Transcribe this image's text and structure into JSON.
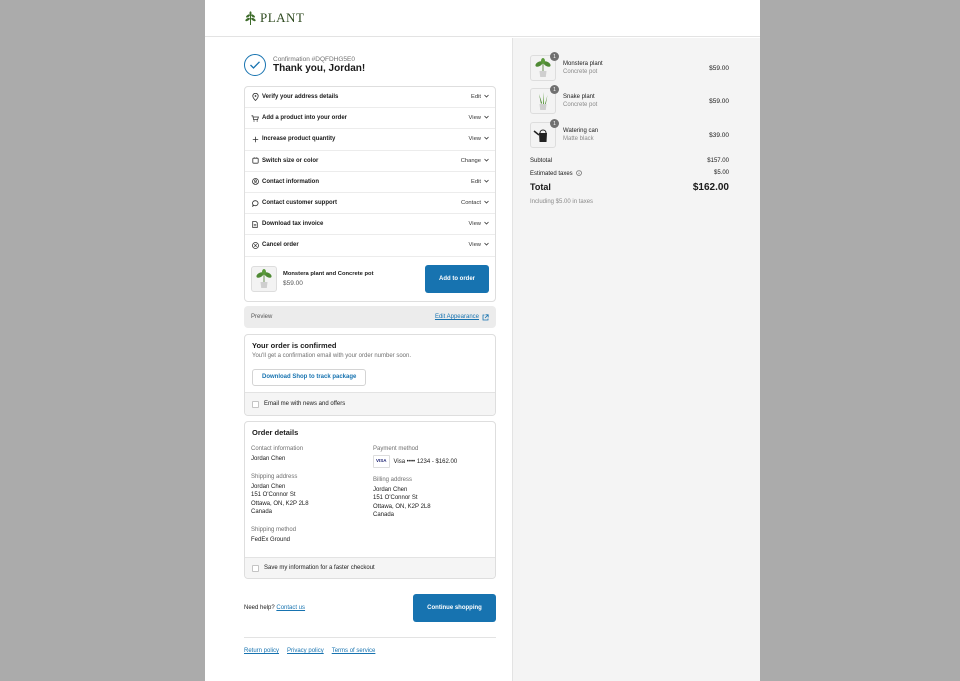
{
  "brand": {
    "name": "PLANT"
  },
  "confirmation": {
    "number": "Confirmation #DQFDHG5E0",
    "title": "Thank you, Jordan!"
  },
  "actions": [
    {
      "label": "Verify your address details",
      "action": "Edit",
      "icon": "location-pin-icon"
    },
    {
      "label": "Add a product into your order",
      "action": "View",
      "icon": "cart-icon"
    },
    {
      "label": "Increase product quantity",
      "action": "View",
      "icon": "plus-icon"
    },
    {
      "label": "Switch size or color",
      "action": "Change",
      "icon": "swap-icon"
    },
    {
      "label": "Contact information",
      "action": "Edit",
      "icon": "user-icon"
    },
    {
      "label": "Contact customer support",
      "action": "Contact",
      "icon": "chat-icon"
    },
    {
      "label": "Download tax invoice",
      "action": "View",
      "icon": "document-icon"
    },
    {
      "label": "Cancel order",
      "action": "View",
      "icon": "cancel-icon"
    }
  ],
  "upsell": {
    "name": "Monstera plant and Concrete pot",
    "price": "$59.00",
    "button": "Add to order"
  },
  "preview": {
    "label": "Preview",
    "link": "Edit Appearance"
  },
  "order_confirmed": {
    "title": "Your order is confirmed",
    "subtitle": "You'll get a confirmation email with your order number soon.",
    "button": "Download Shop to track package",
    "checkbox": "Email me with news and offers"
  },
  "order_details": {
    "title": "Order details",
    "contact_label": "Contact information",
    "contact_value": "Jordan Chen",
    "payment_label": "Payment method",
    "payment_brand": "VISA",
    "payment_value": "Visa •••• 1234 - $162.00",
    "shipping_label": "Shipping address",
    "shipping_lines": [
      "Jordan Chen",
      "151 O'Connor St",
      "Ottawa, ON, K2P 2L8",
      "Canada"
    ],
    "billing_label": "Billing address",
    "billing_lines": [
      "Jordan Chen",
      "151 O'Connor St",
      "Ottawa, ON, K2P 2L8",
      "Canada"
    ],
    "method_label": "Shipping method",
    "method_value": "FedEx Ground",
    "checkbox": "Save my information for a faster checkout"
  },
  "help": {
    "text": "Need help?",
    "link": "Contact us",
    "button": "Continue shopping"
  },
  "footer": {
    "links": [
      "Return policy",
      "Privacy policy",
      "Terms of service"
    ]
  },
  "cart": {
    "items": [
      {
        "name": "Monstera plant",
        "variant": "Concrete pot",
        "price": "$59.00",
        "qty": "1"
      },
      {
        "name": "Snake plant",
        "variant": "Concrete pot",
        "price": "$59.00",
        "qty": "1"
      },
      {
        "name": "Watering can",
        "variant": "Matte black",
        "price": "$39.00",
        "qty": "1"
      }
    ],
    "subtotal_label": "Subtotal",
    "subtotal": "$157.00",
    "taxes_label": "Estimated taxes",
    "taxes": "$5.00",
    "total_label": "Total",
    "total": "$162.00",
    "tax_note": "Including $5.00 in taxes"
  },
  "colors": {
    "accent": "#1773b0",
    "backdrop": "#ababab",
    "sidebar": "#f4f4f4"
  }
}
